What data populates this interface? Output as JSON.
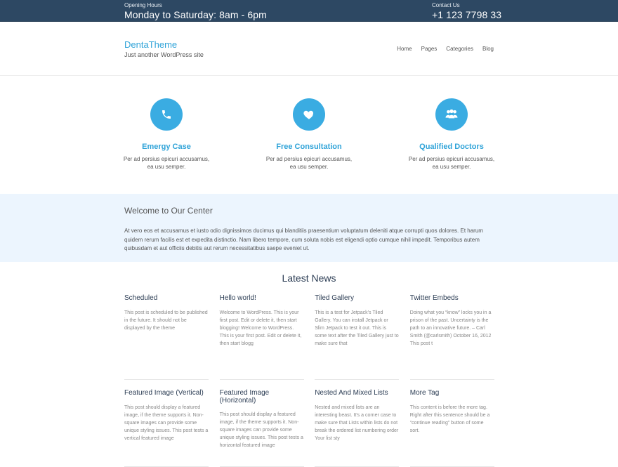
{
  "topbar": {
    "hours_label": "Opening Hours",
    "hours_value": "Monday to Saturday: 8am - 6pm",
    "contact_label": "Contact Us",
    "contact_value": "+1 123 7798 33"
  },
  "header": {
    "site_title": "DentaTheme",
    "tagline": "Just another WordPress site",
    "nav": [
      "Home",
      "Pages",
      "Categories",
      "Blog"
    ]
  },
  "features": [
    {
      "icon": "phone-icon",
      "title": "Emergy Case",
      "desc_line1": "Per ad persius epicuri accusamus,",
      "desc_line2": "ea usu semper."
    },
    {
      "icon": "heart-icon",
      "title": "Free Consultation",
      "desc_line1": "Per ad persius epicuri accusamus,",
      "desc_line2": "ea usu semper."
    },
    {
      "icon": "users-icon",
      "title": "Qualified Doctors",
      "desc_line1": "Per ad persius epicuri accusamus,",
      "desc_line2": "ea usu semper."
    }
  ],
  "welcome": {
    "title": "Welcome to Our Center",
    "text": "At vero eos et accusamus et iusto odio dignissimos ducimus qui blanditiis praesentium voluptatum deleniti atque corrupti quos dolores. Et harum quidem rerum facilis est et expedita distinctio. Nam libero tempore, cum soluta nobis est eligendi optio cumque nihil impedit. Temporibus autem quibusdam et aut officiis debitis aut rerum necessitatibus saepe eveniet ut."
  },
  "news": {
    "title": "Latest News",
    "posts": [
      {
        "title": "Scheduled",
        "excerpt": "This post is scheduled to be published in the future. It should not be displayed by the theme"
      },
      {
        "title": "Hello world!",
        "excerpt": "Welcome to WordPress. This is your first post. Edit or delete it, then start blogging! Welcome to WordPress. This is your first post. Edit or delete it, then start blogg"
      },
      {
        "title": "Tiled Gallery",
        "excerpt": "This is a test for Jetpack's Tiled Gallery. You can install Jetpack or Slim Jetpack to test it out. This is some text after the Tiled Gallery just to make sure that"
      },
      {
        "title": "Twitter Embeds",
        "excerpt": "Doing what you “know” locks you in a prison of the past. Uncertainty is the path to an innovative future. – Carl Smith (@carlsmith) October 16, 2012 This post t"
      },
      {
        "title": "Featured Image (Vertical)",
        "excerpt": "This post should display a featured image, if the theme supports it. Non-square images can provide some unique styling issues. This post tests a vertical featured image"
      },
      {
        "title": "Featured Image (Horizontal)",
        "excerpt": "This post should display a featured image, if the theme supports it. Non-square images can provide some unique styling issues. This post tests a horizontal featured image"
      },
      {
        "title": "Nested And Mixed Lists",
        "excerpt": "Nested and mixed lists are an interesting beast. It's a corner case to make sure that Lists within lists do not break the ordered list numbering order Your list sty"
      },
      {
        "title": "More Tag",
        "excerpt": "This content is before the more tag. Right after this sentence should be a “continue reading” button of some sort."
      }
    ]
  },
  "colors": {
    "topbar_bg": "#2d4863",
    "accent": "#3aace2",
    "welcome_bg": "#ecf5fe"
  }
}
